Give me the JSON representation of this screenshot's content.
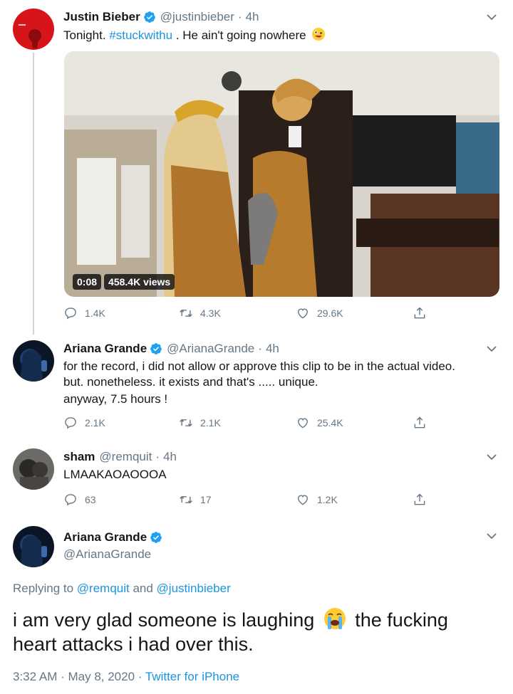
{
  "tweets": [
    {
      "name": "Justin Bieber",
      "handle": "@justinbieber",
      "time": "4h",
      "text_prefix": "Tonight. ",
      "hashtag": "#stuckwithu",
      "text_suffix": " . He ain't going nowhere",
      "emoji": "zany-face-emoji",
      "video": {
        "duration": "0:08",
        "views": "458.4K views"
      },
      "replies": "1.4K",
      "retweets": "4.3K",
      "likes": "29.6K"
    },
    {
      "name": "Ariana Grande",
      "handle": "@ArianaGrande",
      "time": "4h",
      "lines": [
        "for the record, i did not allow or approve this clip to be in the actual video.",
        "but. nonetheless. it exists and that's ..... unique.",
        "anyway, 7.5 hours !"
      ],
      "replies": "2.1K",
      "retweets": "2.1K",
      "likes": "25.4K"
    },
    {
      "name": "sham",
      "handle": "@remquit",
      "time": "4h",
      "text": "LMAAKAOAOOOA",
      "replies": "63",
      "retweets": "17",
      "likes": "1.2K"
    }
  ],
  "focus": {
    "name": "Ariana Grande",
    "handle": "@ArianaGrande",
    "replying_prefix": "Replying to ",
    "replying_user1": "@remquit",
    "replying_and": " and ",
    "replying_user2": "@justinbieber",
    "text_part1": "i am very glad someone is laughing",
    "emoji": "loudly-crying-face-emoji",
    "text_part2": "the fucking",
    "text_line2": "heart attacks i had over this.",
    "timestamp": "3:32 AM · May 8, 2020 · ",
    "source": "Twitter for iPhone"
  },
  "icons": {
    "reply": "reply-icon",
    "retweet": "retweet-icon",
    "like": "heart-icon",
    "share": "share-icon",
    "verified": "verified-badge-icon",
    "more": "chevron-down-icon"
  },
  "colors": {
    "accent": "#1b95e0",
    "verified": "#1da1f2",
    "muted": "#657786",
    "text": "#14171a"
  }
}
